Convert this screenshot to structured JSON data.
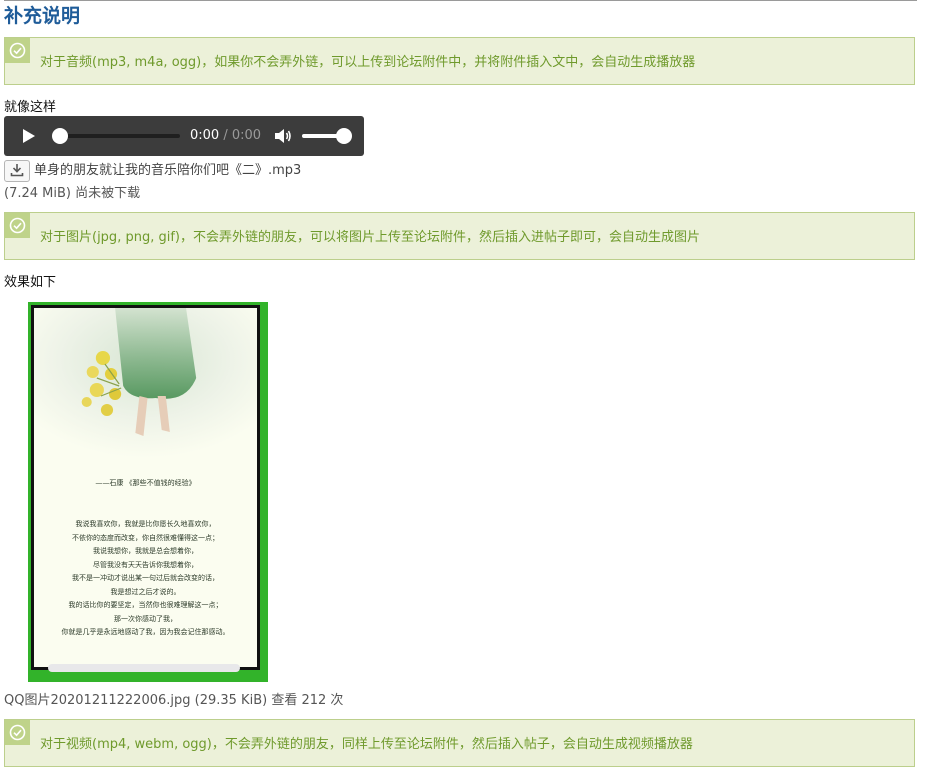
{
  "heading": "补充说明",
  "notices": {
    "audio": "对于音频(mp3, m4a, ogg)，如果你不会弄外链，可以上传到论坛附件中，并将附件插入文中，会自动生成播放器",
    "image": "对于图片(jpg, png, gif)，不会弄外链的朋友，可以将图片上传至论坛附件，然后插入进帖子即可，会自动生成图片",
    "video": "对于视频(mp4, webm, ogg)，不会弄外链的朋友，同样上传至论坛附件，然后插入帖子，会自动生成视频播放器"
  },
  "audio_example_label": "就像这样",
  "player": {
    "current_time": "0:00",
    "separator": " / ",
    "duration": "0:00",
    "progress_fraction": 0.0,
    "volume_fraction": 1.0
  },
  "attachment": {
    "file_name": "单身的朋友就让我的音乐陪你们吧《二》.mp3",
    "meta": "(7.24 MiB) 尚未被下载"
  },
  "image_example_label": "效果如下",
  "photo": {
    "poem_title": "——石康 《那些不值钱的经验》",
    "poem_lines": [
      "我说我喜欢你，我就是比你愿长久地喜欢你，",
      "不依你的态度而改变，你自然很难懂得这一点；",
      "我说我想你，我就是总会想着你，",
      "尽管我没有天天告诉你我想着你，",
      "我不是一冲动才说出某一句过后就会改变的话，",
      "我是想过之后才说的。",
      "我的话比你的要坚定，当然你也很难理解这一点；",
      "那一次你感动了我，",
      "你就是几乎是永远地感动了我，因为我会记住那感动。"
    ],
    "caption": "QQ图片20201211222006.jpg (29.35 KiB) 查看 212 次"
  },
  "colors": {
    "heading": "#1f5c99",
    "notice_bg": "#ecf1d9",
    "notice_border": "#bccf8c",
    "notice_text": "#6f9a2c",
    "player_bg": "#3c3c3c",
    "photo_frame": "#32b32a"
  }
}
